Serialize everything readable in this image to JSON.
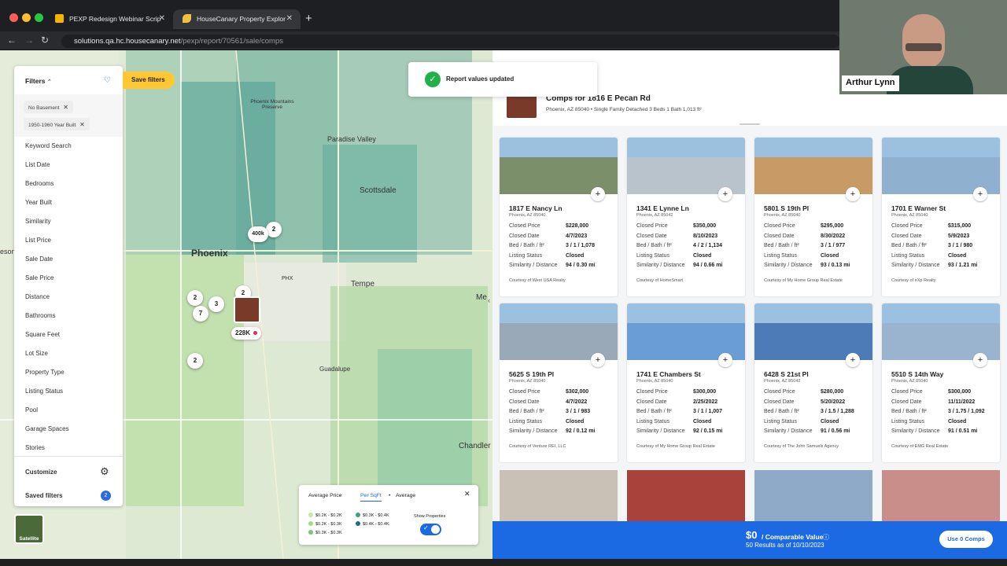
{
  "browser": {
    "tabs": [
      {
        "title": "PEXP Redesign Webinar Scrip",
        "active": false
      },
      {
        "title": "HouseCanary Property Explor",
        "active": true
      }
    ],
    "url_domain": "solutions.qa.hc.housecanary.net",
    "url_path": "/pexp/report/70561/sale/comps"
  },
  "toast": {
    "text": "Report values updated"
  },
  "filters": {
    "title": "Filters",
    "active_chips": [
      "No Basement",
      "1950-1960 Year Built"
    ],
    "items": [
      "Keyword Search",
      "List Date",
      "Bedrooms",
      "Year Built",
      "Similarity",
      "List Price",
      "Sale Date",
      "Sale Price",
      "Distance",
      "Bathrooms",
      "Square Feet",
      "Lot Size",
      "Property Type",
      "Listing Status",
      "Pool",
      "Garage Spaces",
      "Stories"
    ],
    "customize": "Customize",
    "saved_filters": "Saved filters",
    "saved_count": "2",
    "save_button": "Save filters"
  },
  "map": {
    "labels": [
      "Phoenix Mountains Preserve",
      "Paradise Valley",
      "Scottsdale",
      "Phoenix",
      "PHX",
      "Tempe",
      "Guadalupe",
      "Chandler",
      "Me",
      "eson"
    ],
    "clusters": [
      "2",
      "400k",
      "2",
      "3",
      "7",
      "2",
      "2"
    ],
    "subject_price": "228K",
    "satellite": "Satellite"
  },
  "legend": {
    "tabs": [
      "Average Price",
      "Per SqFt",
      "Average"
    ],
    "ranges": [
      "$0.2K - $0.2K",
      "$0.2K - $0.3K",
      "$0.3K - $0.3K",
      "$0.3K - $0.4K",
      "$0.4K - $0.4K"
    ],
    "show_properties": "Show Properties",
    "colors": [
      "#c9e6a8",
      "#a6d88a",
      "#7dc47a",
      "#3f9e86",
      "#1f6f78"
    ]
  },
  "subject": {
    "title": "Comps for 1816 E Pecan Rd",
    "details": "Phoenix, AZ 85040 • Single Family Detached  3 Beds  1 Bath  1,013 ft²"
  },
  "field_labels": [
    "Closed Price",
    "Closed Date",
    "Bed / Bath / ft²",
    "Listing Status",
    "Similarity / Distance"
  ],
  "comps": [
    {
      "address": "1817 E Nancy Ln",
      "city": "Phoenix, AZ 85040",
      "price": "$228,000",
      "date": "4/7/2023",
      "bbf": "3 / 1 / 1,078",
      "status": "Closed",
      "sim": "94 / 0.30 mi",
      "courtesy": "Courtesy of West USA Realty",
      "color": "#7a8f6a"
    },
    {
      "address": "1341 E Lynne Ln",
      "city": "Phoenix, AZ 85042",
      "price": "$350,000",
      "date": "8/10/2023",
      "bbf": "4 / 2 / 1,134",
      "status": "Closed",
      "sim": "94 / 0.66 mi",
      "courtesy": "Courtesy of HomeSmart",
      "color": "#b9c3cc"
    },
    {
      "address": "5801 S 19th Pl",
      "city": "Phoenix, AZ 85040",
      "price": "$295,000",
      "date": "8/30/2022",
      "bbf": "3 / 1 / 977",
      "status": "Closed",
      "sim": "93 / 0.13 mi",
      "courtesy": "Courtesy of My Home Group Real Estate",
      "color": "#c89a66"
    },
    {
      "address": "1701 E Warner St",
      "city": "Phoenix, AZ 85040",
      "price": "$315,000",
      "date": "5/9/2023",
      "bbf": "3 / 1 / 980",
      "status": "Closed",
      "sim": "93 / 1.21 mi",
      "courtesy": "Courtesy of eXp Realty",
      "color": "#8fb0cf"
    },
    {
      "address": "5625 S 19th Pl",
      "city": "Phoenix, AZ 85040",
      "price": "$302,000",
      "date": "4/7/2022",
      "bbf": "3 / 1 / 983",
      "status": "Closed",
      "sim": "92 / 0.12 mi",
      "courtesy": "Courtesy of Venture REI, LLC",
      "color": "#9aa9b8"
    },
    {
      "address": "1741 E Chambers St",
      "city": "Phoenix, AZ 85040",
      "price": "$300,000",
      "date": "2/25/2022",
      "bbf": "3 / 1 / 1,007",
      "status": "Closed",
      "sim": "92 / 0.15 mi",
      "courtesy": "Courtesy of My Home Group Real Estate",
      "color": "#6a9cd6"
    },
    {
      "address": "6428 S 21st Pl",
      "city": "Phoenix, AZ 85042",
      "price": "$280,000",
      "date": "5/20/2022",
      "bbf": "3 / 1.5 / 1,288",
      "status": "Closed",
      "sim": "91 / 0.56 mi",
      "courtesy": "Courtesy of The John Samuels Agency",
      "color": "#4d7bb8"
    },
    {
      "address": "5510 S 14th Way",
      "city": "Phoenix, AZ 85040",
      "price": "$300,000",
      "date": "11/11/2022",
      "bbf": "3 / 1.75 / 1,092",
      "status": "Closed",
      "sim": "91 / 0.51 mi",
      "courtesy": "Courtesy of EMG Real Estate",
      "color": "#9ab4cf"
    }
  ],
  "bottom": {
    "value": "$0",
    "value_label": "/ Comparable Value",
    "results": "50 Results as of 10/10/2023",
    "button": "Use 0 Comps"
  },
  "video": {
    "name": "Arthur Lynn"
  }
}
